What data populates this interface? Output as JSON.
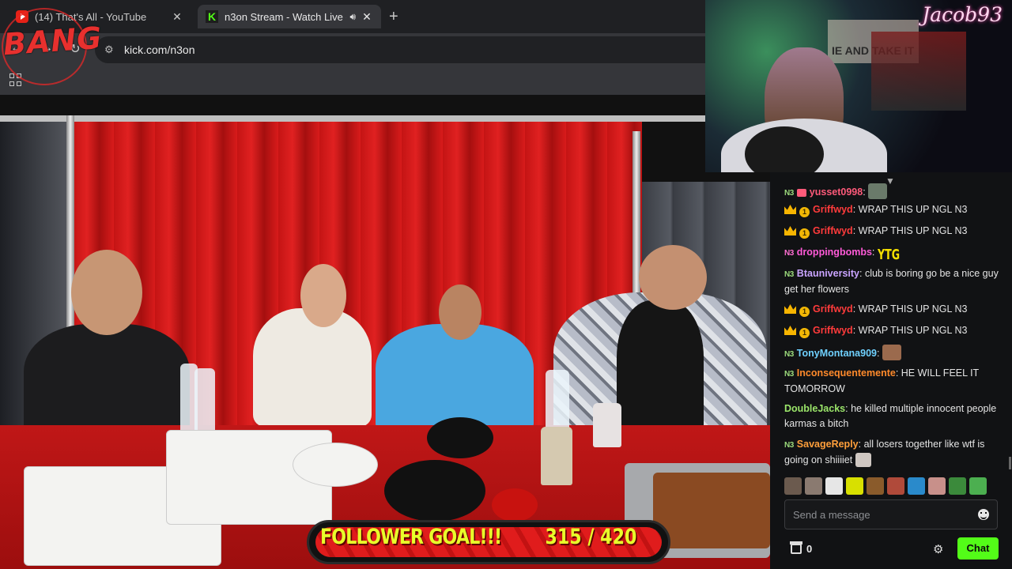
{
  "browser": {
    "tabs": [
      {
        "title": "(14) That's All - YouTube",
        "icon": "youtube-icon"
      },
      {
        "title": "n3on Stream - Watch Live o",
        "icon": "kick-icon",
        "active": true
      }
    ],
    "new_tab": "+",
    "url": "kick.com/n3on"
  },
  "overlay": {
    "logo": "BANG",
    "follower_goal": {
      "label": "FOLLOWER GOAL!!!",
      "count_text": "315 / 420",
      "current": 315,
      "target": 420
    }
  },
  "webcam": {
    "name": "Jacob93",
    "poster_text": "IE AND TAKE IT"
  },
  "chat": {
    "messages": [
      {
        "badges": [
          "n3",
          "gift"
        ],
        "user": "yusset0998",
        "user_color": "#ff5a7a",
        "text": "",
        "emote": "pepe"
      },
      {
        "badges": [
          "crown",
          "coin"
        ],
        "user": "Griffwyd",
        "user_color": "#ff3b3b",
        "text": "WRAP THIS UP NGL N3"
      },
      {
        "badges": [
          "crown",
          "coin"
        ],
        "user": "Griffwyd",
        "user_color": "#ff3b3b",
        "text": "WRAP THIS UP NGL N3"
      },
      {
        "badges": [
          "n3pink"
        ],
        "user": "droppingbombs",
        "user_color": "#ff5ad8",
        "text": "",
        "emote_text": "YTG"
      },
      {
        "badges": [
          "n3"
        ],
        "user": "Btauniversity",
        "user_color": "#c9a4ff",
        "text": "club is boring go be a nice guy get her flowers"
      },
      {
        "badges": [
          "crown",
          "coin"
        ],
        "user": "Griffwyd",
        "user_color": "#ff3b3b",
        "text": "WRAP THIS UP NGL N3"
      },
      {
        "badges": [
          "crown",
          "coin"
        ],
        "user": "Griffwyd",
        "user_color": "#ff3b3b",
        "text": "WRAP THIS UP NGL N3"
      },
      {
        "badges": [
          "n3"
        ],
        "user": "TonyMontana909",
        "user_color": "#6fd1ff",
        "text": "",
        "emote": "face"
      },
      {
        "badges": [
          "n3"
        ],
        "user": "Inconsequentemente",
        "user_color": "#ff8a2b",
        "text": "HE WILL FEEL IT TOMORROW"
      },
      {
        "badges": [],
        "user": "DoubleJacks",
        "user_color": "#9be66a",
        "text": "he killed multiple innocent people karmas a bitch"
      },
      {
        "badges": [
          "n3"
        ],
        "user": "SavageReply",
        "user_color": "#ff9f3b",
        "text": "all losers together like wtf is going on shiiiiet",
        "emote": "cat"
      }
    ],
    "input_placeholder": "Send a message",
    "points": "0",
    "send_label": "Chat"
  },
  "colors": {
    "kick_green": "#53fc18",
    "curtain_red": "#d81b1b",
    "goal_yellow": "#e8ff2a"
  }
}
